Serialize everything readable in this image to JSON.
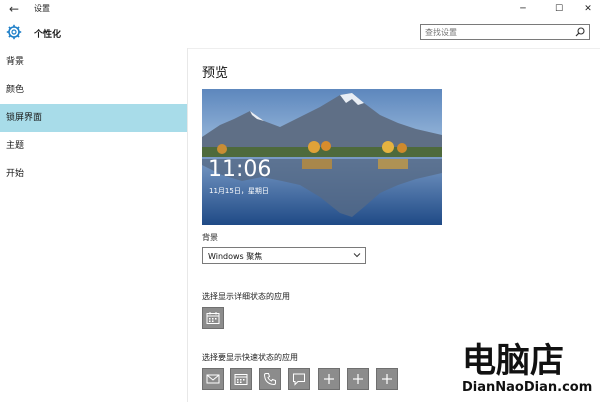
{
  "window": {
    "title": "设置",
    "back_glyph": "←",
    "minimize_glyph": "─",
    "maximize_glyph": "☐",
    "close_glyph": "✕"
  },
  "header": {
    "title": "个性化",
    "icon": "gear-icon"
  },
  "search": {
    "placeholder": "查找设置",
    "icon": "search-icon"
  },
  "sidebar": {
    "items": [
      {
        "label": "背景",
        "active": false
      },
      {
        "label": "颜色",
        "active": false
      },
      {
        "label": "锁屏界面",
        "active": true
      },
      {
        "label": "主题",
        "active": false
      },
      {
        "label": "开始",
        "active": false
      }
    ],
    "active_color": "#a8dce9"
  },
  "main": {
    "preview_title": "预览",
    "preview_time": "11:06",
    "preview_date": "11月15日，星期日",
    "background_label": "背景",
    "background_value": "Windows 聚焦",
    "detailed_status_label": "选择显示详细状态的应用",
    "detailed_status_app": "calendar-icon",
    "quick_status_label": "选择要显示快速状态的应用",
    "quick_status_apps": [
      "mail-icon",
      "calendar-icon",
      "phone-icon",
      "message-icon",
      "plus-icon",
      "plus-icon",
      "plus-icon"
    ]
  },
  "watermark": {
    "logo_text": "电脑店",
    "url_text": "DianNaoDian.com"
  }
}
